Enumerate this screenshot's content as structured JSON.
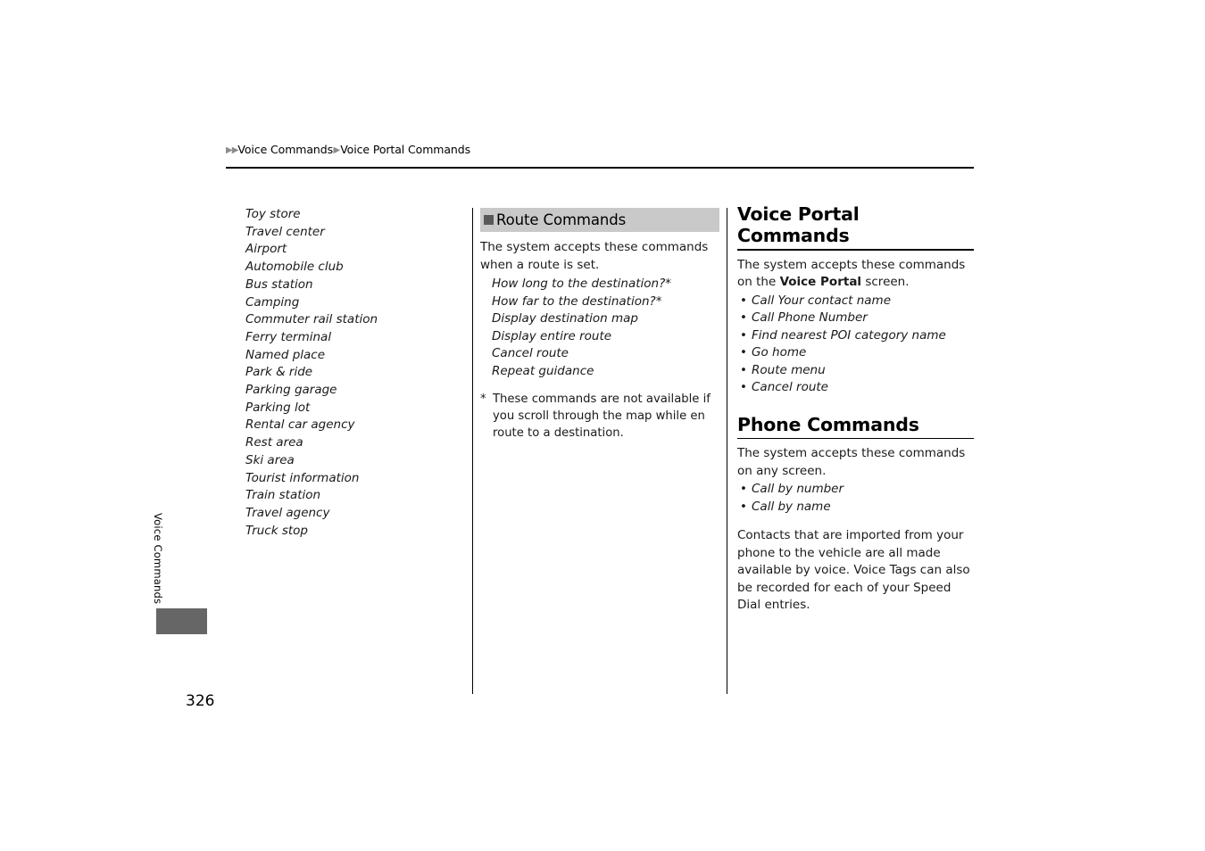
{
  "breadcrumb": {
    "marker": "▶▶",
    "separator": "▶",
    "level1": "Voice Commands",
    "level2": "Voice Portal Commands"
  },
  "side_tab": {
    "label": "Voice Commands"
  },
  "page_number": "326",
  "column1": {
    "poi_items": [
      "Toy store",
      "Travel center",
      "Airport",
      "Automobile club",
      "Bus station",
      "Camping",
      "Commuter rail station",
      "Ferry terminal",
      "Named place",
      "Park & ride",
      "Parking garage",
      "Parking lot",
      "Rental car agency",
      "Rest area",
      "Ski area",
      "Tourist information",
      "Train station",
      "Travel agency",
      "Truck stop"
    ]
  },
  "column2": {
    "section_title": "Route Commands",
    "intro": "The system accepts these commands when a route is set.",
    "commands": [
      "How long to the destination?*",
      "How far to the destination?*",
      "Display destination map",
      "Display entire route",
      "Cancel route",
      "Repeat guidance"
    ],
    "footnote_mark": "*",
    "footnote_text": "These commands are not available if you scroll through the map while en route to a destination."
  },
  "column3": {
    "voice_portal": {
      "heading": "Voice Portal Commands",
      "intro_part1": "The system accepts these commands on the ",
      "intro_bold": "Voice Portal",
      "intro_part2": " screen.",
      "bullet": "•",
      "commands": [
        "Call Your contact name",
        "Call Phone Number",
        "Find nearest POI category name",
        "Go home",
        "Route menu",
        "Cancel route"
      ]
    },
    "phone": {
      "heading": "Phone Commands",
      "intro": "The system accepts these commands on any screen.",
      "bullet": "•",
      "commands": [
        "Call by number",
        "Call by name"
      ],
      "note": "Contacts that are imported from your phone to the vehicle are all made available by voice. Voice Tags can also be recorded for each of your Speed Dial entries."
    }
  },
  "colors": {
    "section_bar": "#c9c9c9",
    "section_square": "#595959",
    "side_tab_block": "#666666",
    "breadcrumb_marker": "#8c8c8c"
  }
}
